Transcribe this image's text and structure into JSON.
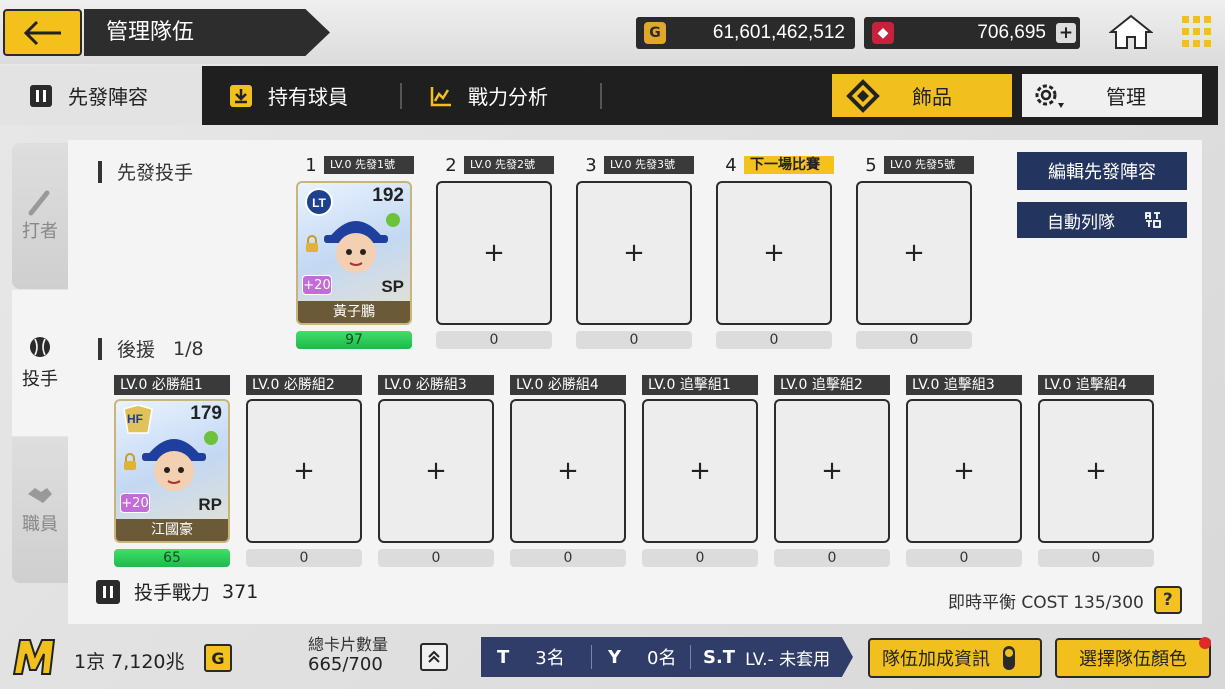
{
  "header": {
    "title": "管理隊伍",
    "gold": "61,601,462,512",
    "gems": "706,695"
  },
  "tabs": {
    "lineup": "先發陣容",
    "owned": "持有球員",
    "analysis": "戰力分析",
    "accessory": "飾品",
    "manage": "管理"
  },
  "sidenav": {
    "batter": "打者",
    "pitcher": "投手",
    "staff": "職員"
  },
  "starters": {
    "title": "先發投手",
    "slots": [
      {
        "num": "1",
        "tag": "LV.0 先發1號",
        "value": "97"
      },
      {
        "num": "2",
        "tag": "LV.0 先發2號",
        "value": "0"
      },
      {
        "num": "3",
        "tag": "LV.0 先發3號",
        "value": "0"
      },
      {
        "num": "4",
        "tag": "下一場比賽",
        "value": "0"
      },
      {
        "num": "5",
        "tag": "LV.0 先發5號",
        "value": "0"
      }
    ],
    "card": {
      "rating": "192",
      "position": "SP",
      "bonus": "+20",
      "name": "黃子鵬"
    }
  },
  "relief": {
    "title": "後援",
    "count": "1/8",
    "slots": [
      {
        "tag": "LV.0 必勝組1",
        "value": "65"
      },
      {
        "tag": "LV.0 必勝組2",
        "value": "0"
      },
      {
        "tag": "LV.0 必勝組3",
        "value": "0"
      },
      {
        "tag": "LV.0 必勝組4",
        "value": "0"
      },
      {
        "tag": "LV.0 追擊組1",
        "value": "0"
      },
      {
        "tag": "LV.0 追擊組2",
        "value": "0"
      },
      {
        "tag": "LV.0 追擊組3",
        "value": "0"
      },
      {
        "tag": "LV.0 追擊組4",
        "value": "0"
      }
    ],
    "card": {
      "rating": "179",
      "position": "RP",
      "bonus": "+20",
      "name": "江國豪",
      "badge": "HF"
    }
  },
  "empty_slot_symbol": "+",
  "buttons": {
    "edit_lineup": "編輯先發陣容",
    "auto_lineup": "自動列隊",
    "team_bonus": "隊伍加成資訊",
    "team_color": "選擇隊伍顏色"
  },
  "pitcher_power": {
    "label": "投手戰力",
    "value": "371"
  },
  "cost": {
    "label": "即時平衡 COST 135/300",
    "help": "?"
  },
  "footer": {
    "money": "1京 7,120兆",
    "money_icon": "G",
    "card_count_label": "總卡片數量",
    "card_count_value": "665/700",
    "team_t_label": "T",
    "team_t_value": "3名",
    "team_y_label": "Y",
    "team_y_value": "0名",
    "team_st_label": "S.T",
    "team_st_value": "LV.- 未套用"
  },
  "colors": {
    "accent_yellow": "#f1c01f",
    "navy": "#23345e",
    "dark": "#1f1f1f",
    "green": "#2ecc5a"
  }
}
